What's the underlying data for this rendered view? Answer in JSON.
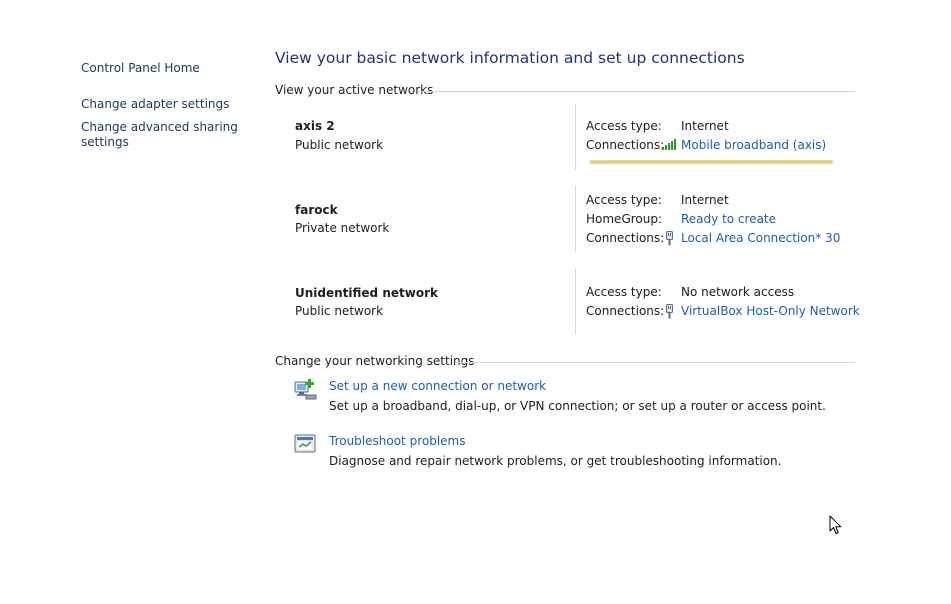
{
  "sidebar": {
    "home": "Control Panel Home",
    "items": [
      {
        "label": "Change adapter settings"
      },
      {
        "label_line1": "Change advanced sharing",
        "label_line2": "settings"
      }
    ]
  },
  "main": {
    "title": "View your basic network information and set up connections",
    "active_networks_heading": "View your active networks",
    "networks": [
      {
        "name": "axis  2",
        "category": "Public network",
        "rows": [
          {
            "label": "Access type:",
            "value": "Internet",
            "icon": ""
          },
          {
            "label": "Connections:",
            "value": "Mobile broadband (axis)",
            "icon": "signal-bars-icon",
            "link": true
          }
        ]
      },
      {
        "name": "farock",
        "category": "Private network",
        "rows": [
          {
            "label": "Access type:",
            "value": "Internet",
            "icon": ""
          },
          {
            "label": "HomeGroup:",
            "value": "Ready to create",
            "icon": "",
            "link": true
          },
          {
            "label": "Connections:",
            "value": "Local Area Connection* 30",
            "icon": "ethernet-icon",
            "link": true
          }
        ]
      },
      {
        "name": "Unidentified network",
        "category": "Public network",
        "rows": [
          {
            "label": "Access type:",
            "value": "No network access",
            "icon": ""
          },
          {
            "label": "Connections:",
            "value": "VirtualBox Host-Only Network",
            "icon": "ethernet-icon",
            "link": true
          }
        ]
      }
    ],
    "change_settings_heading": "Change your networking settings",
    "tasks": [
      {
        "title": "Set up a new connection or network",
        "description": "Set up a broadband, dial-up, or VPN connection; or set up a router or access point.",
        "icon": "new-connection-icon"
      },
      {
        "title": "Troubleshoot problems",
        "description": "Diagnose and repair network problems, or get troubleshooting information.",
        "icon": "troubleshoot-icon"
      }
    ]
  },
  "colors": {
    "link": "#1f5fa8",
    "title": "#1e3287",
    "signal": "#2e9a2e"
  }
}
